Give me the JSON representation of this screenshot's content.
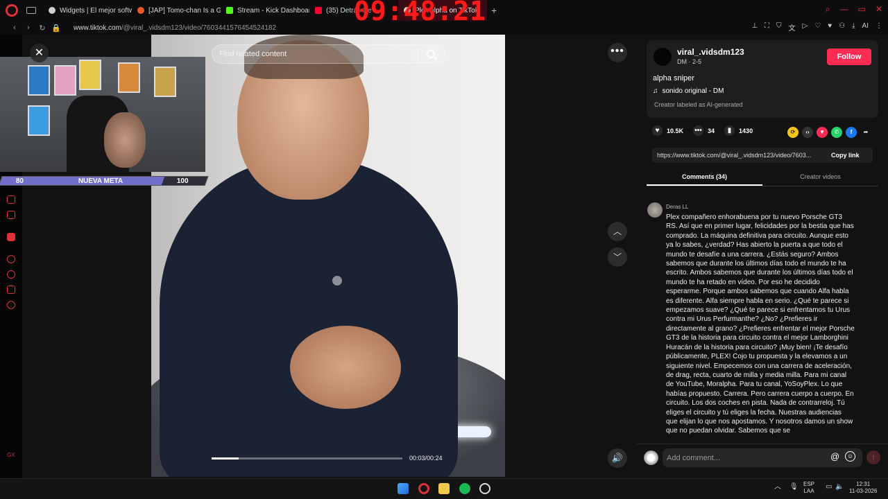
{
  "browser": {
    "tabs": [
      {
        "label": "Widgets | El mejor software",
        "color": "#cfcfcf"
      },
      {
        "label": "[JAP] Tomo-chan Is a Girl",
        "color": "#e8592b"
      },
      {
        "label": "Stream - Kick Dashboard",
        "color": "#53fc18"
      },
      {
        "label": "(35) Detrás De ...",
        "color": "#ff0033"
      },
      {
        "label": "Plex alpha on TikTok",
        "color": "#ffffff"
      }
    ],
    "clock_overlay": "09:48:21",
    "url_host": "www.tiktok.com",
    "url_path": "/@viral_.vidsdm123/video/7603441576454524182"
  },
  "webcam": {
    "goal_start": "80",
    "goal_label": "NUEVA META",
    "goal_end": "100",
    "goal_progress": 0.79
  },
  "video": {
    "search_placeholder": "Find related content",
    "time": "00:03/00:24",
    "progress": 0.14
  },
  "creator": {
    "username": "viral_.vidsdm123",
    "subtitle": "DM · 2-5",
    "follow_label": "Follow",
    "description": "alpha sniper",
    "sound": "sonido original - DM",
    "ai_label": "Creator labeled as AI-generated"
  },
  "stats": {
    "likes": "10.5K",
    "comments": "34",
    "saves": "1430"
  },
  "share": {
    "link": "https://www.tiktok.com/@viral_.vidsdm123/video/7603...",
    "copy_label": "Copy link"
  },
  "panel_tabs": {
    "comments": "Comments (34)",
    "creator_videos": "Creator videos"
  },
  "comment": {
    "author": "Deras LL",
    "text": "Plex compañero enhorabuena por tu nuevo Porsche GT3 RS. Así que en primer lugar, felicidades por la bestia que has comprado. La máquina definitiva para circuito. Aunque esto ya lo sabes, ¿verdad? Has abierto la puerta a que todo el mundo te desafíe a una carrera. ¿Estás seguro? Ambos sabemos que durante los últimos días todo el mundo te ha escrito. Ambos sabemos que durante los últimos días todo el mundo te ha retado en vídeo. Por eso he decidido esperarme. Porque ambos sabemos que cuando Alfa habla es diferente. Alfa siempre habla en serio. ¿Qué te parece si empezamos suave? ¿Qué te parece si enfrentamos tu Urus contra mi Urus Perfurmanthe? ¿No? ¿Prefieres ir directamente al grano? ¿Prefieres enfrentar el mejor Porsche GT3 de la historia para circuito contra el mejor Lamborghini Huracán de la historia para circuito? ¡Muy bien! ¡Te desafío públicamente, PLEX! Cojo tu propuesta y la elevamos a un siguiente nivel. Empecemos con una carrera de aceleración, de drag, recta, cuarto de milla y media milla. Para mi canal de YouTube, Moralpha. Para tu canal, YoSoyPlex. Lo que habías propuesto. Carrera. Pero carrera cuerpo a cuerpo. En circuito. Los dos coches en pista. Nada de contrarreloj. Tú eliges el circuito y tú eliges la fecha. Nuestras audiencias que elijan lo que nos apostamos. Y nosotros damos un show que no puedan olvidar. Sabemos que se"
  },
  "composer": {
    "placeholder": "Add comment..."
  },
  "taskbar": {
    "lang_top": "ESP",
    "lang_bottom": "LAA",
    "time": "12:31",
    "date": "11-03-2026"
  },
  "colors": {
    "accent": "#fe2c55",
    "opera": "#e0313b"
  }
}
